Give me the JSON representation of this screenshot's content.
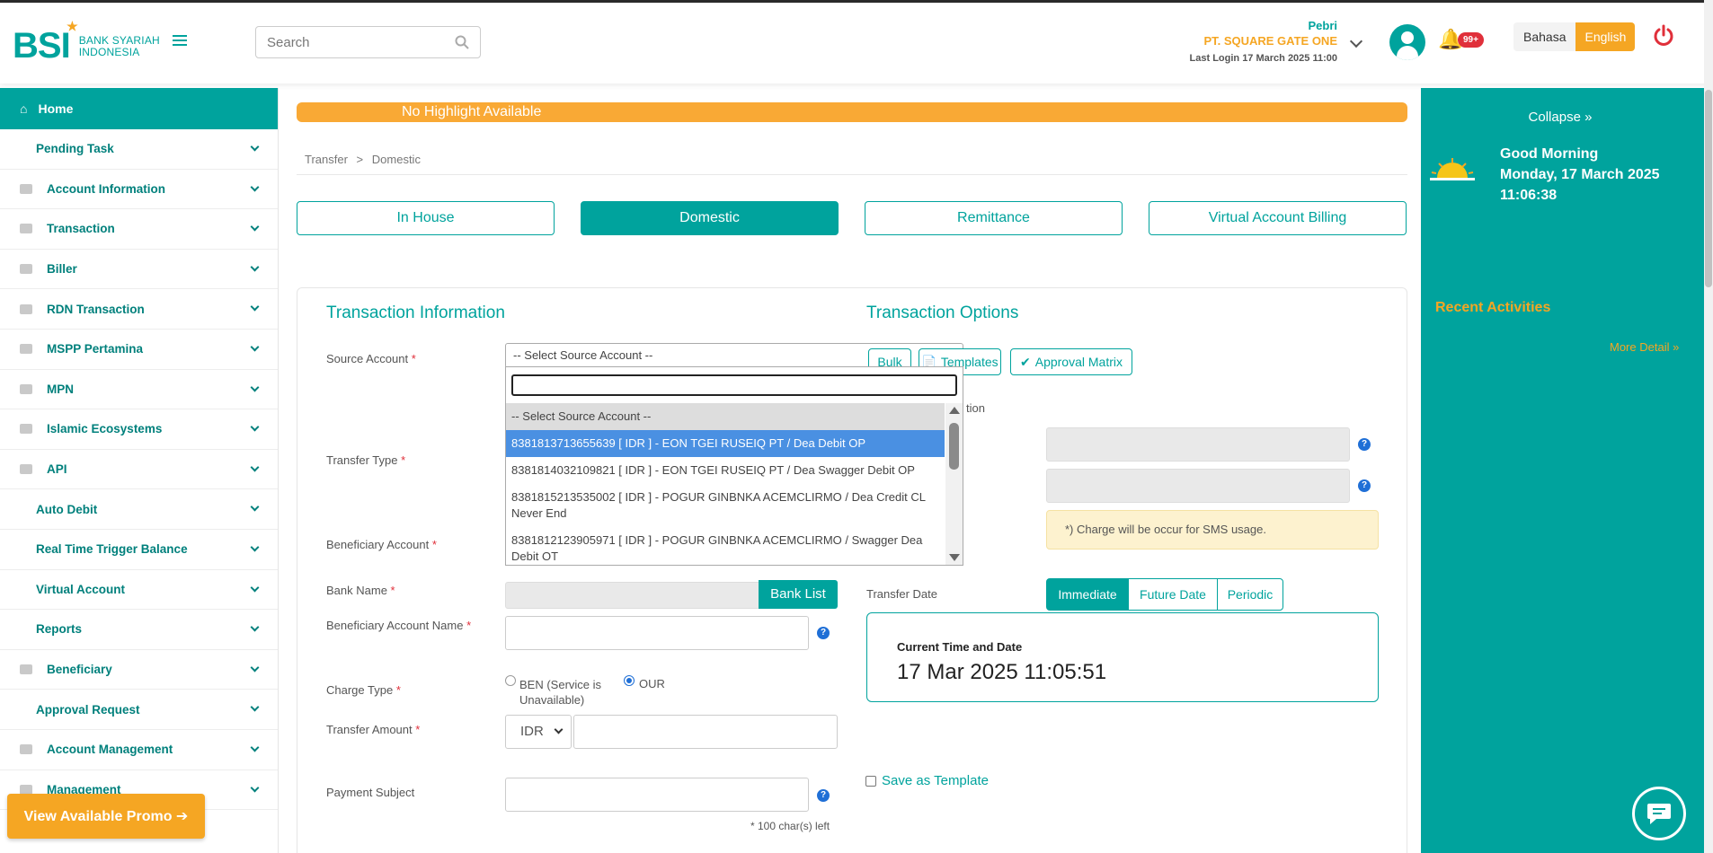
{
  "brand": {
    "logo_text": "BSI",
    "logo_line1": "BANK SYARIAH",
    "logo_line2": "INDONESIA",
    "accent": "#00a39d",
    "orange": "#f5a623"
  },
  "header": {
    "search_placeholder": "Search",
    "user_name": "Pebri",
    "company": "PT. SQUARE GATE ONE",
    "last_login": "Last Login 17 March 2025 11:00",
    "notification_count": "99+",
    "lang_bahasa": "Bahasa",
    "lang_english": "English"
  },
  "sidebar": {
    "home": "Home",
    "items": [
      {
        "label": "Pending Task",
        "icon": "none"
      },
      {
        "label": "Account Information",
        "icon": "folder-icon"
      },
      {
        "label": "Transaction",
        "icon": "briefcase-icon"
      },
      {
        "label": "Biller",
        "icon": "warning-icon"
      },
      {
        "label": "RDN Transaction",
        "icon": "briefcase-icon"
      },
      {
        "label": "MSPP Pertamina",
        "icon": "briefcase-icon"
      },
      {
        "label": "MPN",
        "icon": "briefcase-icon"
      },
      {
        "label": "Islamic Ecosystems",
        "icon": "handshake-icon"
      },
      {
        "label": "API",
        "icon": "briefcase-icon"
      },
      {
        "label": "Auto Debit",
        "icon": "none"
      },
      {
        "label": "Real Time Trigger Balance",
        "icon": "none"
      },
      {
        "label": "Virtual Account",
        "icon": "none"
      },
      {
        "label": "Reports",
        "icon": "none"
      },
      {
        "label": "Beneficiary",
        "icon": "folder-icon"
      },
      {
        "label": "Approval Request",
        "icon": "none"
      },
      {
        "label": "Account Management",
        "icon": "users-icon"
      },
      {
        "label": "Management",
        "icon": "user-icon"
      }
    ],
    "promo": "View Available Promo ➔"
  },
  "main": {
    "highlight": "No Highlight Available",
    "breadcrumb": {
      "parent": "Transfer",
      "sep": ">",
      "current": "Domestic"
    },
    "tabs": [
      "In House",
      "Domestic",
      "Remittance",
      "Virtual Account Billing"
    ],
    "info_title": "Transaction Information",
    "options_title": "Transaction Options",
    "labels": {
      "source": "Source Account",
      "transfer_type": "Transfer Type",
      "beneficiary": "Beneficiary Account",
      "bank_name": "Bank Name",
      "ben_name": "Beneficiary Account Name",
      "charge_type": "Charge Type",
      "amount": "Transfer Amount",
      "subject": "Payment Subject",
      "transfer_date": "Transfer Date",
      "partial_option": "tion"
    },
    "source_select": "-- Select Source Account --",
    "dropdown": [
      "-- Select Source Account --",
      "8381813713655639 [ IDR ] - EON TGEI RUSEIQ PT / Dea Debit OP",
      "8381814032109821 [ IDR ] - EON TGEI RUSEIQ PT / Dea Swagger Debit OP",
      "8381815213535002 [ IDR ] - POGUR GINBNKA ACEMCLIRMO / Dea Credit CL Never End",
      "8381812123905971 [ IDR ] - POGUR GINBNKA ACEMCLIRMO / Swagger Dea Debit OT"
    ],
    "bank_list": "Bank List",
    "charge_ben": "BEN (Service is Unavailable)",
    "charge_our": "OUR",
    "currency": "IDR",
    "chars_left": "* 100  char(s) left",
    "btn_bulk": "Bulk",
    "btn_templates": "Templates",
    "btn_matrix": "Approval Matrix",
    "sms_note": "*) Charge will be occur for SMS usage.",
    "date_options": [
      "Immediate",
      "Future Date",
      "Periodic"
    ],
    "time_label": "Current Time and Date",
    "time_value": "17 Mar 2025 11:05:51",
    "save_template": "Save as Template"
  },
  "right_panel": {
    "collapse": "Collapse »",
    "greeting": "Good Morning",
    "date": "Monday, 17 March 2025",
    "time": "11:06:38",
    "recent": "Recent Activities",
    "more": "More Detail »"
  }
}
